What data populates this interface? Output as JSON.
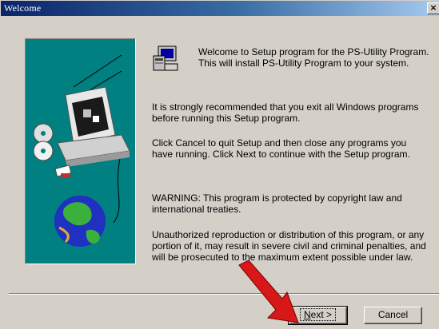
{
  "window": {
    "title": "Welcome",
    "close_glyph": "×"
  },
  "art": {
    "icon": "computer-cd-globe-illustration"
  },
  "header": {
    "icon": "setup-computer-icon",
    "line1": "Welcome to Setup program for the PS-Utility Program.",
    "line2": "This will install PS-Utility Program to your system."
  },
  "body": {
    "p1_line1": "It is strongly recommended that you exit all Windows programs",
    "p1_line2": "before running this Setup program.",
    "p2_line1": "Click Cancel to quit Setup and then close any programs you",
    "p2_line2": "have running.  Click Next to continue with the Setup program.",
    "p3_line1": "WARNING: This program is protected by copyright law and",
    "p3_line2": "international treaties.",
    "p4_line1": "Unauthorized reproduction or distribution of this program, or any",
    "p4_line2": "portion of it, may result in severe civil and criminal penalties, and",
    "p4_line3": "will be prosecuted to the maximum extent possible under law."
  },
  "buttons": {
    "next_mnemonic": "N",
    "next_rest": "ext >",
    "cancel": "Cancel"
  },
  "overlay": {
    "icon": "red-arrow-pointer",
    "color": "#d81818"
  },
  "colors": {
    "panel": "#008080",
    "titlebar": "#0a246a",
    "face": "#d4d0c8"
  }
}
